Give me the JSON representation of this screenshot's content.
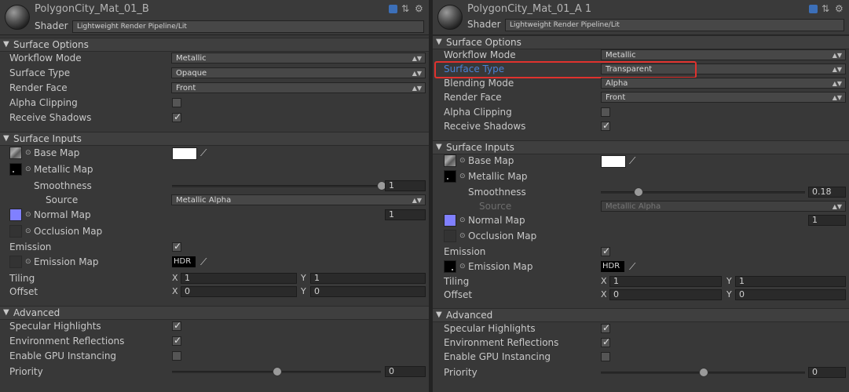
{
  "left": {
    "title": "PolygonCity_Mat_01_B",
    "shader_label": "Shader",
    "shader_value": "Lightweight Render Pipeline/Lit",
    "sections": {
      "surface_options": "Surface Options",
      "surface_inputs": "Surface Inputs",
      "advanced": "Advanced"
    },
    "workflow_mode": {
      "label": "Workflow Mode",
      "value": "Metallic"
    },
    "surface_type": {
      "label": "Surface Type",
      "value": "Opaque"
    },
    "render_face": {
      "label": "Render Face",
      "value": "Front"
    },
    "alpha_clipping": {
      "label": "Alpha Clipping",
      "checked": false
    },
    "receive_shadows": {
      "label": "Receive Shadows",
      "checked": true
    },
    "base_map": "Base Map",
    "metallic_map": "Metallic Map",
    "smoothness": {
      "label": "Smoothness",
      "value": "1",
      "fraction": 1.0
    },
    "source": {
      "label": "Source",
      "value": "Metallic Alpha"
    },
    "normal_map": {
      "label": "Normal Map",
      "value": "1"
    },
    "occlusion_map": "Occlusion Map",
    "emission": {
      "label": "Emission",
      "checked": true
    },
    "emission_map": {
      "label": "Emission Map",
      "hdr": "HDR"
    },
    "tiling": {
      "label": "Tiling",
      "x": "1",
      "y": "1"
    },
    "offset": {
      "label": "Offset",
      "x": "0",
      "y": "0"
    },
    "specular_highlights": {
      "label": "Specular Highlights",
      "checked": true
    },
    "environment_reflections": {
      "label": "Environment Reflections",
      "checked": true
    },
    "gpu_instancing": {
      "label": "Enable GPU Instancing",
      "checked": false
    },
    "priority": {
      "label": "Priority",
      "value": "0",
      "fraction": 0.5
    }
  },
  "right": {
    "title": "PolygonCity_Mat_01_A 1",
    "shader_label": "Shader",
    "shader_value": "Lightweight Render Pipeline/Lit",
    "sections": {
      "surface_options": "Surface Options",
      "surface_inputs": "Surface Inputs",
      "advanced": "Advanced"
    },
    "workflow_mode": {
      "label": "Workflow Mode",
      "value": "Metallic"
    },
    "surface_type": {
      "label": "Surface Type",
      "value": "Transparent"
    },
    "blending_mode": {
      "label": "Blending Mode",
      "value": "Alpha"
    },
    "render_face": {
      "label": "Render Face",
      "value": "Front"
    },
    "alpha_clipping": {
      "label": "Alpha Clipping",
      "checked": false
    },
    "receive_shadows": {
      "label": "Receive Shadows",
      "checked": true
    },
    "base_map": "Base Map",
    "metallic_map": "Metallic Map",
    "smoothness": {
      "label": "Smoothness",
      "value": "0.18",
      "fraction": 0.18
    },
    "source": {
      "label": "Source",
      "value": "Metallic Alpha"
    },
    "normal_map": {
      "label": "Normal Map",
      "value": "1"
    },
    "occlusion_map": "Occlusion Map",
    "emission": {
      "label": "Emission",
      "checked": true
    },
    "emission_map": {
      "label": "Emission Map",
      "hdr": "HDR"
    },
    "tiling": {
      "label": "Tiling",
      "x": "1",
      "y": "1"
    },
    "offset": {
      "label": "Offset",
      "x": "0",
      "y": "0"
    },
    "specular_highlights": {
      "label": "Specular Highlights",
      "checked": true
    },
    "environment_reflections": {
      "label": "Environment Reflections",
      "checked": true
    },
    "gpu_instancing": {
      "label": "Enable GPU Instancing",
      "checked": false
    },
    "priority": {
      "label": "Priority",
      "value": "0",
      "fraction": 0.5
    }
  },
  "axis_labels": {
    "x": "X",
    "y": "Y"
  },
  "colors": {
    "highlight": "#e0322e",
    "accent_label": "#4a82d6"
  },
  "icons": {
    "book": "book-icon",
    "settings": "gear-icon",
    "layout": "layout-icon",
    "picker": "eyedropper-icon"
  }
}
